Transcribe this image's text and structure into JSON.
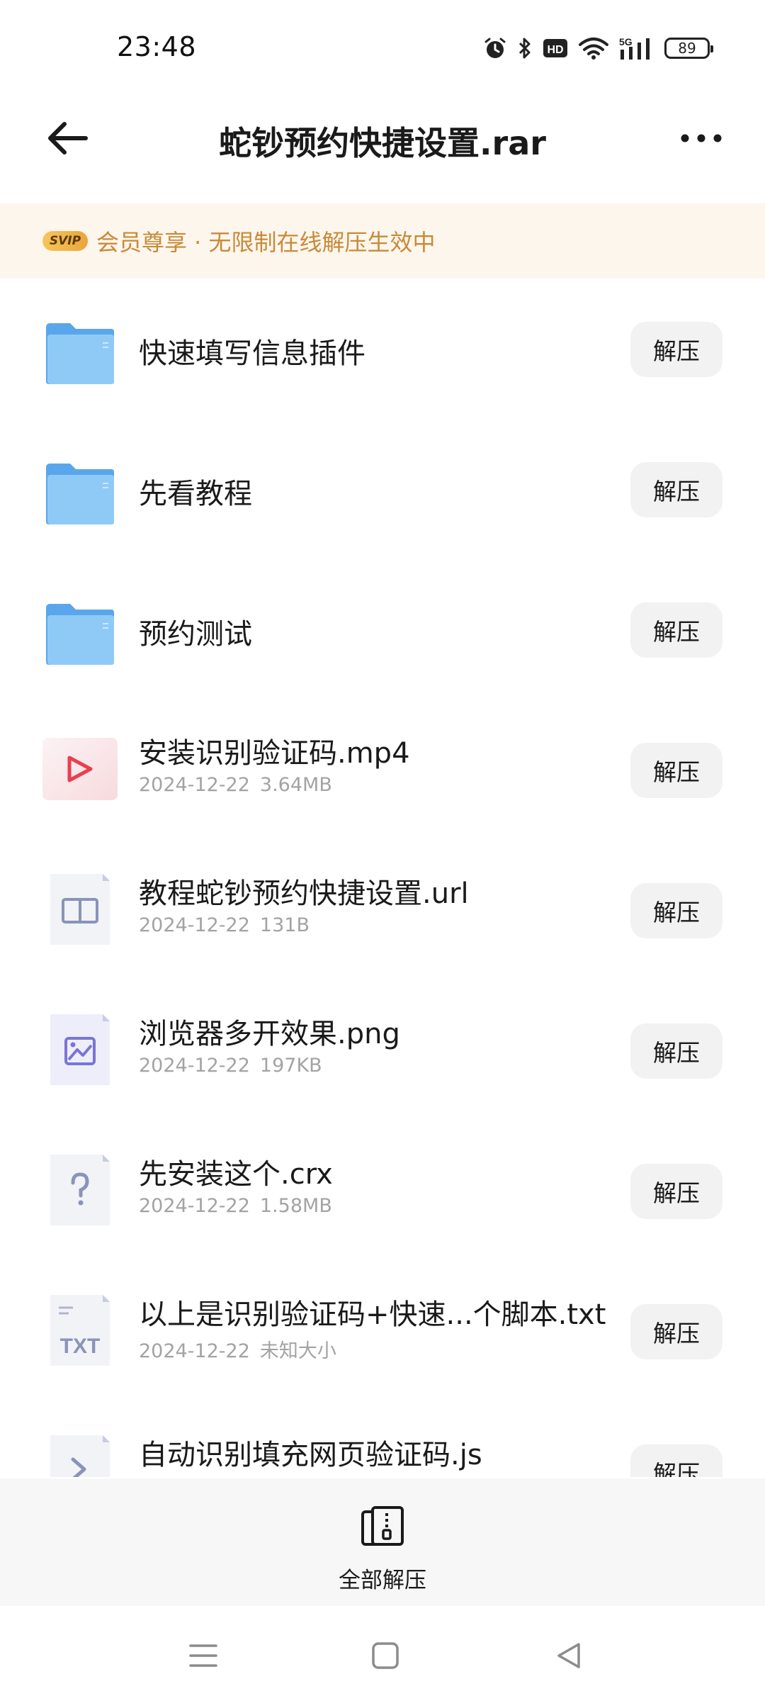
{
  "status_bar": {
    "time": "23:48",
    "icons": [
      "alarm-icon",
      "bluetooth-icon",
      "hd-icon",
      "wifi-icon",
      "5g-signal-icon",
      "battery-icon"
    ],
    "hd_label": "HD",
    "network_label": "5G",
    "battery_level": "89"
  },
  "header": {
    "title": "蛇钞预约快捷设置.rar",
    "back_icon": "arrow-left-icon",
    "more_icon": "more-dots-icon"
  },
  "vip_banner": {
    "badge": "SVIP",
    "text": "会员尊享 · 无限制在线解压生效中",
    "color": "#c88a3a"
  },
  "file_list": {
    "extract_label": "解压",
    "items": [
      {
        "name": "快速填写信息插件",
        "type": "folder",
        "icon": "folder-icon"
      },
      {
        "name": "先看教程",
        "type": "folder",
        "icon": "folder-icon"
      },
      {
        "name": "预约测试",
        "type": "folder",
        "icon": "folder-icon"
      },
      {
        "name": "安装识别验证码.mp4",
        "type": "video",
        "icon": "video-file-icon",
        "date": "2024-12-22",
        "size": "3.64MB"
      },
      {
        "name": "教程蛇钞预约快捷设置.url",
        "type": "url",
        "icon": "url-file-icon",
        "date": "2024-12-22",
        "size": "131B"
      },
      {
        "name": "浏览器多开效果.png",
        "type": "image",
        "icon": "image-file-icon",
        "date": "2024-12-22",
        "size": "197KB"
      },
      {
        "name": "先安装这个.crx",
        "type": "unknown",
        "icon": "unknown-file-icon",
        "date": "2024-12-22",
        "size": "1.58MB"
      },
      {
        "name": "以上是识别验证码+快速...个脚本.txt",
        "type": "txt",
        "icon": "txt-file-icon",
        "date": "2024-12-22",
        "size": "未知大小"
      },
      {
        "name": "自动识别填充网页验证码.js",
        "type": "script",
        "icon": "script-file-icon",
        "date": "",
        "size": ""
      }
    ]
  },
  "bottom_bar": {
    "extract_all_label": "全部解压",
    "extract_all_icon": "zip-archive-icon"
  },
  "nav_bar": {
    "items": [
      "menu-icon",
      "home-square-icon",
      "back-triangle-icon"
    ]
  },
  "colors": {
    "folder": "#6cb4f2",
    "video_accent": "#e94050",
    "banner_bg": "#fdf6ec",
    "button_bg": "#f2f2f2"
  }
}
